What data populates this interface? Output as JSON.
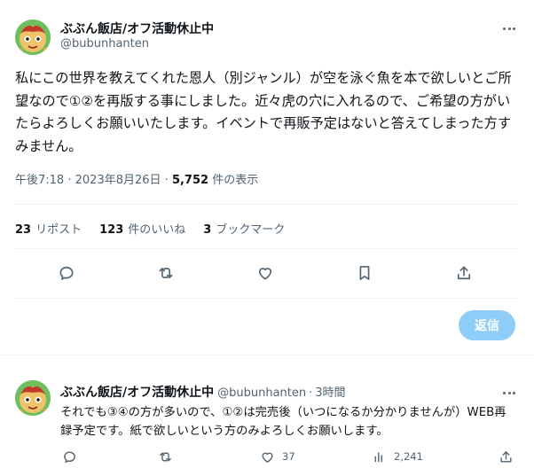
{
  "main_tweet": {
    "author_name": "ぶぶん飯店/オフ活動休止中",
    "handle": "@bubunhanten",
    "text": "私にこの世界を教えてくれた恩人（別ジャンル）が空を泳ぐ魚を本で欲しいとご所望なので①②を再版する事にしました。近々虎の穴に入れるので、ご希望の方がいたらよろしくお願いいたします。イベントで再販予定はないと答えてしまった方すみません。",
    "time": "午後7:18",
    "date": "2023年8月26日",
    "separator": "·",
    "views_count": "5,752",
    "views_label": "件の表示",
    "stats": {
      "reposts_count": "23",
      "reposts_label": "リポスト",
      "likes_count": "123",
      "likes_label": "件のいいね",
      "bookmarks_count": "3",
      "bookmarks_label": "ブックマーク"
    },
    "actions": [
      "reply-icon",
      "repost-icon",
      "like-icon",
      "bookmark-icon",
      "share-icon"
    ]
  },
  "reply_button_label": "返信",
  "reply_tweet": {
    "author_name": "ぶぶん飯店/オフ活動休止中",
    "handle": "@bubunhanten",
    "separator": "·",
    "time": "3時間",
    "text": "それでも③④の方が多いので、①②は完売後（いつになるか分かりませんが）WEB再録予定です。紙で欲しいという方のみよろしくお願いします。",
    "likes": "37",
    "views": "2,241"
  },
  "colors": {
    "accent_disabled": "#8ecdf8",
    "secondary_text": "#536471",
    "primary_text": "#0f1419",
    "divider": "#eff3f4"
  }
}
